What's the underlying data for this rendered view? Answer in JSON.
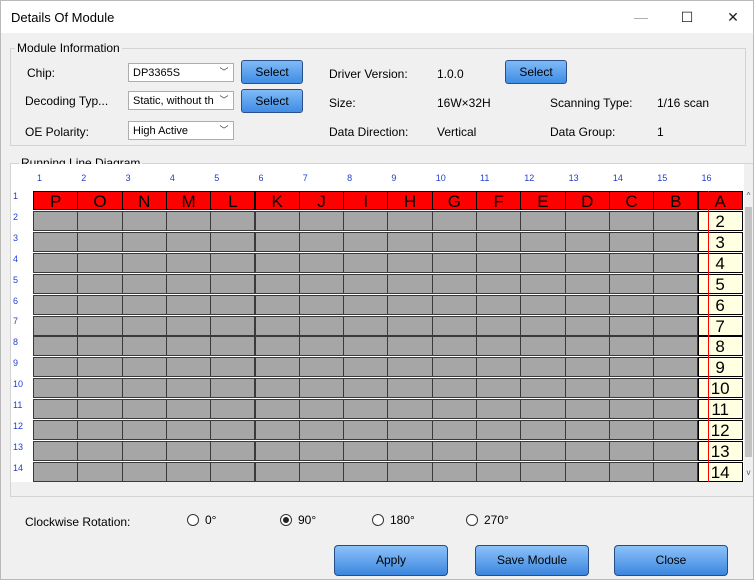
{
  "window": {
    "title": "Details Of Module",
    "min_glyph": "—",
    "max_glyph": "☐",
    "close_glyph": "✕"
  },
  "module_info": {
    "group_label": "Module Information",
    "chip_label": "Chip:",
    "chip_value": "DP3365S",
    "decoding_label": "Decoding Typ...",
    "decoding_value": "Static, without th",
    "oe_label": "OE Polarity:",
    "oe_value": "High Active",
    "select_label": "Select",
    "driver_version_label": "Driver Version:",
    "driver_version_value": "1.0.0",
    "size_label": "Size:",
    "size_value": "16W×32H",
    "scanning_label": "Scanning Type:",
    "scanning_value": "1/16 scan",
    "direction_label": "Data Direction:",
    "direction_value": "Vertical",
    "group_data_label": "Data Group:",
    "group_data_value": "1"
  },
  "diagram": {
    "group_label": "Running Line Diagram",
    "column_numbers": [
      "1",
      "2",
      "3",
      "4",
      "5",
      "6",
      "7",
      "8",
      "9",
      "10",
      "11",
      "12",
      "13",
      "14",
      "15",
      "16"
    ],
    "row_numbers": [
      "1",
      "2",
      "3",
      "4",
      "5",
      "6",
      "7",
      "8",
      "9",
      "10",
      "11",
      "12",
      "13",
      "14"
    ],
    "header_letters": [
      "P",
      "O",
      "N",
      "M",
      "L",
      "K",
      "J",
      "I",
      "H",
      "G",
      "F",
      "E",
      "D",
      "C",
      "B",
      "A"
    ],
    "last_column_values": [
      "2",
      "3",
      "4",
      "5",
      "6",
      "7",
      "8",
      "9",
      "10",
      "11",
      "12",
      "13",
      "14"
    ]
  },
  "rotation": {
    "label": "Clockwise Rotation:",
    "options": [
      "0°",
      "90°",
      "180°",
      "270°"
    ],
    "selected": "90°"
  },
  "buttons": {
    "apply": "Apply",
    "save_module": "Save Module",
    "close": "Close"
  },
  "colors": {
    "header_red": "#ff0000",
    "cell_gray": "#a6a6a6",
    "cell_yellow": "#ffffe1",
    "button_blue": "#3f8de5",
    "index_blue": "#1f3fd0"
  }
}
